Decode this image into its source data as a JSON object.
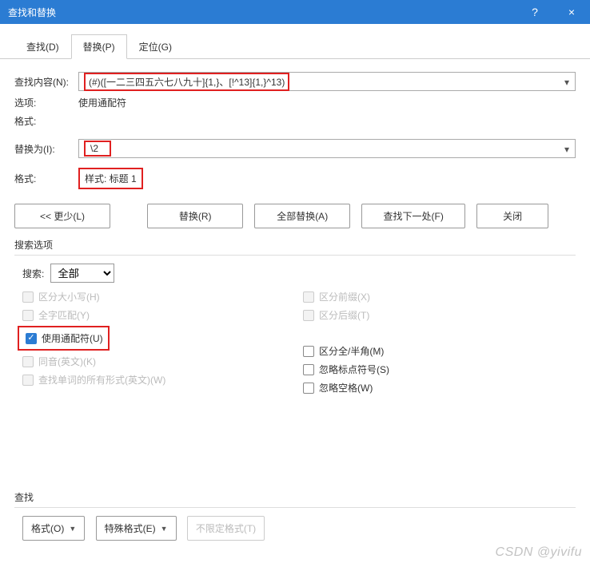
{
  "window": {
    "title": "查找和替换",
    "help": "?",
    "close": "×"
  },
  "tabs": {
    "find": "查找(D)",
    "replace": "替换(P)",
    "goto": "定位(G)"
  },
  "labels": {
    "findWhat": "查找内容(N):",
    "options": "选项:",
    "format1": "格式:",
    "replaceWith": "替换为(I):",
    "format2": "格式:",
    "searchOptions": "搜索选项",
    "search": "搜索:",
    "findSection": "查找"
  },
  "values": {
    "findPattern": "(#)([一二三四五六七八九十]{1,}、[!^13]{1,}^13)",
    "optionsText": "使用通配符",
    "replacePattern": "\\2",
    "replaceFormat": "样式: 标题 1",
    "searchScope": "全部"
  },
  "buttons": {
    "less": "<< 更少(L)",
    "replace": "替换(R)",
    "replaceAll": "全部替换(A)",
    "findNext": "查找下一处(F)",
    "close": "关闭",
    "formatBtn": "格式(O)",
    "specialBtn": "特殊格式(E)",
    "noFormat": "不限定格式(T)"
  },
  "checks": {
    "matchCase": "区分大小写(H)",
    "wholeWord": "全字匹配(Y)",
    "wildcards": "使用通配符(U)",
    "soundsLike": "同音(英文)(K)",
    "wordForms": "查找单词的所有形式(英文)(W)",
    "prefix": "区分前缀(X)",
    "suffix": "区分后缀(T)",
    "fullHalf": "区分全/半角(M)",
    "ignorePunct": "忽略标点符号(S)",
    "ignoreSpace": "忽略空格(W)"
  },
  "watermark": "CSDN @yivifu"
}
